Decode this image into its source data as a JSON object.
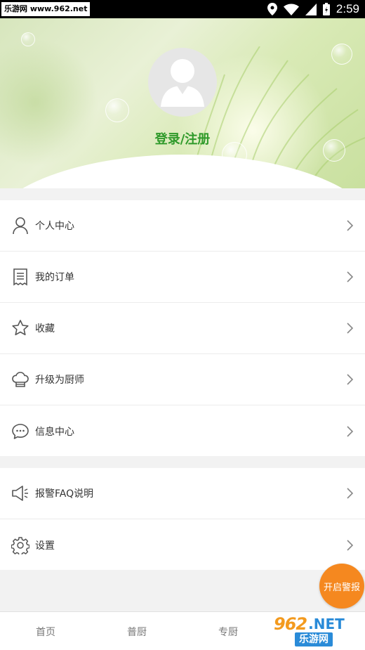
{
  "status_bar": {
    "watermark": "乐游网 www.962.net",
    "time": "2:59"
  },
  "header": {
    "login_label": "登录/注册"
  },
  "menu": {
    "group1": [
      {
        "label": "个人中心",
        "icon": "person-icon"
      },
      {
        "label": "我的订单",
        "icon": "receipt-icon"
      },
      {
        "label": "收藏",
        "icon": "star-icon"
      },
      {
        "label": "升级为厨师",
        "icon": "chef-hat-icon"
      },
      {
        "label": "信息中心",
        "icon": "chat-bubble-icon"
      }
    ],
    "group2": [
      {
        "label": "报警FAQ说明",
        "icon": "megaphone-icon"
      },
      {
        "label": "设置",
        "icon": "gear-icon"
      }
    ]
  },
  "alarm_button": {
    "label": "开启警报",
    "color": "#f5881f"
  },
  "bottom_nav": {
    "tabs": [
      "首页",
      "普厨",
      "专厨"
    ]
  },
  "watermark_logo": {
    "number": "962",
    "suffix": ".NET",
    "text": "乐游网"
  },
  "colors": {
    "accent": "#2f9a2a",
    "icon": "#555555",
    "alarm": "#f5881f"
  }
}
